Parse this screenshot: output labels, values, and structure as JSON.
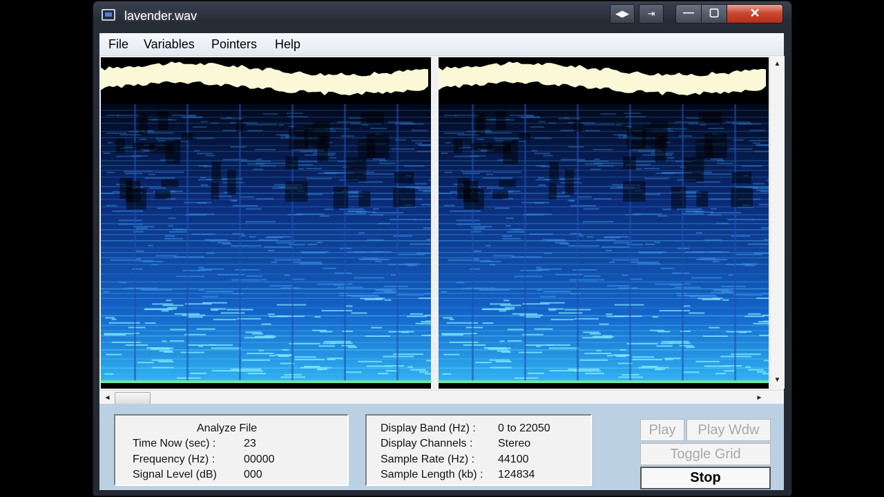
{
  "window": {
    "title": "lavender.wav"
  },
  "caption_buttons": {
    "minimize": "—",
    "maximize": "▢",
    "close": "✕"
  },
  "menu": [
    "File",
    "Variables",
    "Pointers",
    "Help"
  ],
  "icons": {
    "app": "app-icon",
    "extra1": "swap-icon",
    "extra2": "export-icon",
    "scroll_up": "▲",
    "scroll_down": "▼",
    "scroll_left": "◄",
    "scroll_right": "►"
  },
  "colors": {
    "waveform": "#fbf8d8",
    "spectrogram_dark": "#04102a",
    "spectrogram_light": "#3fd3ff",
    "bottom_panel": "#bcd0e4"
  },
  "analyze": {
    "heading": "Analyze File",
    "rows": [
      {
        "label": "Time Now (sec) :",
        "value": "23"
      },
      {
        "label": "Frequency (Hz) :",
        "value": "00000"
      },
      {
        "label": "Signal Level (dB)",
        "value": "000"
      }
    ]
  },
  "display": {
    "rows": [
      {
        "label": "Display Band (Hz) :",
        "value": "0 to 22050"
      },
      {
        "label": "Display Channels :",
        "value": "Stereo"
      },
      {
        "label": "Sample Rate (Hz) :",
        "value": "44100"
      },
      {
        "label": "Sample Length (kb) :",
        "value": "124834"
      }
    ]
  },
  "buttons": {
    "play": "Play",
    "play_wdw": "Play Wdw",
    "toggle_grid": "Toggle Grid",
    "stop": "Stop"
  }
}
